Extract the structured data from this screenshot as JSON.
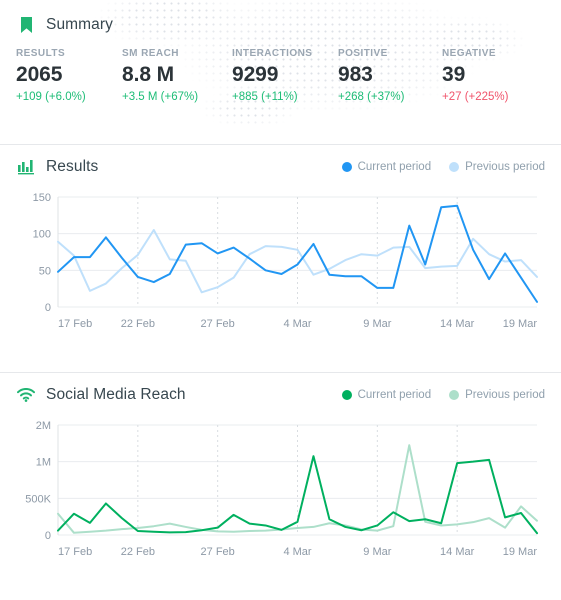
{
  "summary": {
    "icon": "bookmark-icon",
    "title": "Summary",
    "accent_color": "#21b573",
    "positive_color": "#1ebd77",
    "negative_color": "#f0536b",
    "metrics": [
      {
        "label": "RESULTS",
        "value": "2065",
        "delta": "+109  (+6.0%)",
        "direction": "positive"
      },
      {
        "label": "SM REACH",
        "value": "8.8 M",
        "delta": "+3.5 M (+67%)",
        "direction": "positive"
      },
      {
        "label": "INTERACTIONS",
        "value": "9299",
        "delta": "+885 (+11%)",
        "direction": "positive"
      },
      {
        "label": "POSITIVE",
        "value": "983",
        "delta": "+268 (+37%)",
        "direction": "positive"
      },
      {
        "label": "NEGATIVE",
        "value": "39",
        "delta": "+27 (+225%)",
        "direction": "negative"
      }
    ]
  },
  "results_card": {
    "icon": "bar-chart-icon",
    "title": "Results",
    "legend": [
      {
        "label": "Current period",
        "color": "#2196f3"
      },
      {
        "label": "Previous period",
        "color": "#bfe0fb"
      }
    ]
  },
  "reach_card": {
    "icon": "wifi-icon",
    "title": "Social Media Reach",
    "legend": [
      {
        "label": "Current period",
        "color": "#00b05f"
      },
      {
        "label": "Previous period",
        "color": "#addfca"
      }
    ]
  },
  "chart_data": [
    {
      "id": "results",
      "type": "line",
      "title": "Results",
      "xlabel": "",
      "ylabel": "",
      "grid": true,
      "legend_position": "top-right",
      "yticks": [
        0,
        50,
        100,
        150
      ],
      "ytick_labels": [
        "0",
        "50",
        "100",
        "150"
      ],
      "ylim": [
        0,
        150
      ],
      "x": [
        "17 Feb",
        "18 Feb",
        "19 Feb",
        "20 Feb",
        "21 Feb",
        "22 Feb",
        "23 Feb",
        "24 Feb",
        "25 Feb",
        "26 Feb",
        "27 Feb",
        "28 Feb",
        "1 Mar",
        "2 Mar",
        "3 Mar",
        "4 Mar",
        "5 Mar",
        "6 Mar",
        "7 Mar",
        "8 Mar",
        "9 Mar",
        "10 Mar",
        "11 Mar",
        "12 Mar",
        "13 Mar",
        "14 Mar",
        "15 Mar",
        "16 Mar",
        "17 Mar",
        "18 Mar",
        "19 Mar"
      ],
      "xtick_labels": [
        "17 Feb",
        "22 Feb",
        "27 Feb",
        "4 Mar",
        "9 Mar",
        "14 Mar",
        "19 Mar"
      ],
      "xtick_indices": [
        0,
        5,
        10,
        15,
        20,
        25,
        30
      ],
      "series": [
        {
          "name": "Current period",
          "color": "#2196f3",
          "values": [
            48,
            68,
            68,
            95,
            67,
            41,
            34,
            45,
            85,
            87,
            73,
            81,
            66,
            50,
            45,
            58,
            86,
            44,
            42,
            42,
            26,
            26,
            111,
            58,
            136,
            138,
            78,
            38,
            73,
            40,
            7
          ]
        },
        {
          "name": "Previous period",
          "color": "#bfe0fb",
          "values": [
            89,
            70,
            22,
            32,
            53,
            71,
            105,
            65,
            63,
            20,
            27,
            40,
            72,
            83,
            82,
            78,
            44,
            52,
            64,
            72,
            70,
            81,
            82,
            53,
            55,
            56,
            93,
            72,
            62,
            64,
            41
          ]
        }
      ]
    },
    {
      "id": "social_media_reach",
      "type": "line",
      "title": "Social Media Reach",
      "xlabel": "",
      "ylabel": "",
      "grid": true,
      "legend_position": "top-right",
      "yticks": [
        0,
        500000,
        1000000,
        2000000
      ],
      "ytick_labels": [
        "0",
        "500K",
        "1M",
        "2M"
      ],
      "yscale": "nonlinear",
      "ylim": [
        0,
        2000000
      ],
      "x": [
        "17 Feb",
        "18 Feb",
        "19 Feb",
        "20 Feb",
        "21 Feb",
        "22 Feb",
        "23 Feb",
        "24 Feb",
        "25 Feb",
        "26 Feb",
        "27 Feb",
        "28 Feb",
        "1 Mar",
        "2 Mar",
        "3 Mar",
        "4 Mar",
        "5 Mar",
        "6 Mar",
        "7 Mar",
        "8 Mar",
        "9 Mar",
        "10 Mar",
        "11 Mar",
        "12 Mar",
        "13 Mar",
        "14 Mar",
        "15 Mar",
        "16 Mar",
        "17 Mar",
        "18 Mar",
        "19 Mar"
      ],
      "xtick_labels": [
        "17 Feb",
        "22 Feb",
        "27 Feb",
        "4 Mar",
        "9 Mar",
        "14 Mar",
        "19 Mar"
      ],
      "xtick_indices": [
        0,
        5,
        10,
        15,
        20,
        25,
        30
      ],
      "series": [
        {
          "name": "Current period",
          "color": "#00b05f",
          "values": [
            60000,
            290000,
            165000,
            430000,
            230000,
            55000,
            45000,
            35000,
            40000,
            65000,
            100000,
            275000,
            155000,
            130000,
            70000,
            180000,
            1150000,
            215000,
            110000,
            65000,
            130000,
            310000,
            190000,
            215000,
            160000,
            980000,
            1000000,
            1050000,
            240000,
            300000,
            25000
          ]
        },
        {
          "name": "Previous period",
          "color": "#addfca",
          "values": [
            290000,
            30000,
            45000,
            60000,
            80000,
            95000,
            120000,
            155000,
            110000,
            70000,
            50000,
            45000,
            55000,
            60000,
            75000,
            95000,
            110000,
            160000,
            130000,
            75000,
            60000,
            120000,
            1450000,
            180000,
            130000,
            145000,
            175000,
            230000,
            100000,
            390000,
            195000
          ]
        }
      ]
    }
  ]
}
